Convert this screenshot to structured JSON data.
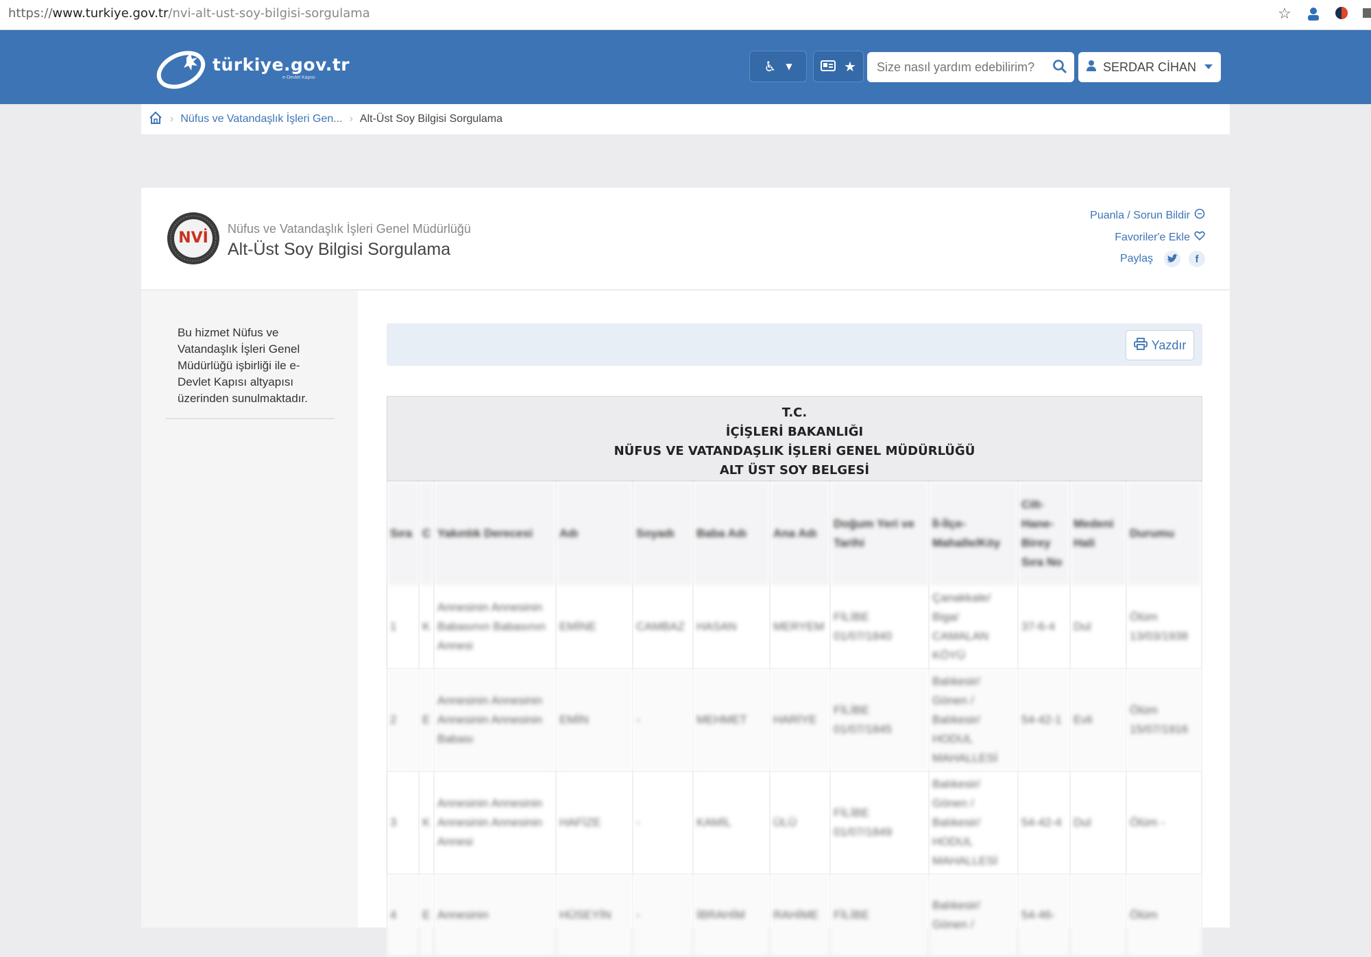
{
  "browser": {
    "url_scheme": "https://",
    "url_domain": "www.turkiye.gov.tr",
    "url_path": "/nvi-alt-ust-soy-bilgisi-sorgulama"
  },
  "header": {
    "logo_text": "türkiye.gov.tr",
    "logo_tagline": "e-Devlet Kapısı",
    "search_placeholder": "Size nasıl yardım edebilirim?",
    "user_name": "SERDAR CİHAN",
    "colors": {
      "brand": "#3d74b5"
    }
  },
  "breadcrumb": {
    "items": [
      "Nüfus ve Vatandaşlık İşleri Gen...",
      "Alt-Üst Soy Bilgisi Sorgulama"
    ]
  },
  "service": {
    "org_name": "Nüfus ve Vatandaşlık İşleri Genel Müdürlüğü",
    "title": "Alt-Üst Soy Bilgisi Sorgulama",
    "logo_text": "NVİ",
    "rate_label": "Puanla / Sorun Bildir",
    "favorite_label": "Favoriler'e Ekle",
    "share_label": "Paylaş"
  },
  "sidebar": {
    "info_text": "Bu hizmet Nüfus ve Vatandaşlık İşleri Genel Müdürlüğü işbirliği ile e-Devlet Kapısı altyapısı üzerinden sunulmaktadır."
  },
  "toolbar": {
    "print_label": "Yazdır"
  },
  "document": {
    "title_lines": [
      "T.C.",
      "İÇİŞLERİ BAKANLIĞI",
      "NÜFUS VE VATANDAŞLIK İŞLERİ GENEL MÜDÜRLÜĞÜ",
      "ALT ÜST SOY BELGESİ"
    ],
    "columns": [
      "Sıra",
      "C",
      "Yakınlık Derecesi",
      "Adı",
      "Soyadı",
      "Baba Adı",
      "Ana Adı",
      "Doğum Yeri ve Tarihi",
      "İl-İlçe-Mahalle/Köy",
      "Cilt-Hane-Birey Sıra No",
      "Medeni Hali",
      "Durumu"
    ],
    "rows": [
      [
        "1",
        "K",
        "Annesinin Annesinin Babasının Babasının Annesi",
        "EMİNE",
        "CAMBAZ",
        "HASAN",
        "MERYEM",
        "FİLİBE 01/07/1840",
        "Çanakkale/ Biga/ CAMALAN KÖYÜ",
        "37-6-4",
        "Dul",
        "Ölüm 13/03/1938"
      ],
      [
        "2",
        "E",
        "Annesinin Annesinin Annesinin Annesinin Babası",
        "EMİN",
        "-",
        "MEHMET",
        "HARİYE",
        "FİLİBE 01/07/1845",
        "Balıkesir/ Gönen / Balıkesir/ HODUL MAHALLESİ",
        "54-42-1",
        "Evli",
        "Ölüm 15/07/1916"
      ],
      [
        "3",
        "K",
        "Annesinin Annesinin Annesinin Annesinin Annesi",
        "HAFİZE",
        "-",
        "KAMİL",
        "ÜLÜ",
        "FİLİBE 01/07/1849",
        "Balıkesir/ Gönen / Balıkesir/ HODUL MAHALLESİ",
        "54-42-4",
        "Dul",
        "Ölüm -"
      ],
      [
        "4",
        "E",
        "Annesinin",
        "HÜSEYİN",
        "-",
        "İBRAHİM",
        "RAHİME",
        "FİLİBE",
        "Balıkesir/ Gönen /",
        "54-46-",
        "",
        "Ölüm"
      ]
    ]
  }
}
